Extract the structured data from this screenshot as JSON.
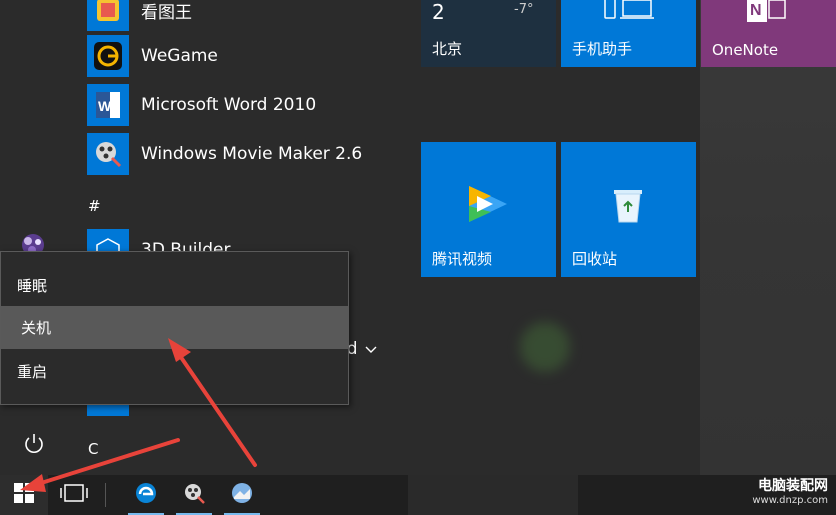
{
  "start_menu": {
    "apps": [
      {
        "label": "看图王",
        "icon": "kantuwang-icon"
      },
      {
        "label": "WeGame",
        "icon": "wegame-icon"
      },
      {
        "label": "Microsoft Word 2010",
        "icon": "word-icon"
      },
      {
        "label": "Windows Movie Maker 2.6",
        "icon": "movie-maker-icon"
      },
      {
        "label": "3D Builder",
        "icon": "3d-builder-icon"
      }
    ],
    "section_hash": "#",
    "section_c": "C",
    "partial_text": "rd"
  },
  "tiles": [
    {
      "label": "北京",
      "temp_main": "2",
      "temp_low": "-7°",
      "color": "#1e3040"
    },
    {
      "label": "手机助手",
      "color": "#0078d7"
    },
    {
      "label": "OneNote",
      "color": "#80397b"
    },
    {
      "label": "腾讯视频",
      "color": "#0078d7"
    },
    {
      "label": "回收站",
      "color": "#0078d7"
    }
  ],
  "power_menu": {
    "items": [
      {
        "label": "睡眠"
      },
      {
        "label": "关机"
      },
      {
        "label": "重启"
      }
    ],
    "highlighted_index": 1
  },
  "watermark": {
    "title": "电脑装配网",
    "url": "www.dnzp.com"
  },
  "colors": {
    "accent": "#0078d7",
    "arrow": "#e8433a",
    "menu_bg": "#2b2b2b",
    "hover": "#595959"
  }
}
